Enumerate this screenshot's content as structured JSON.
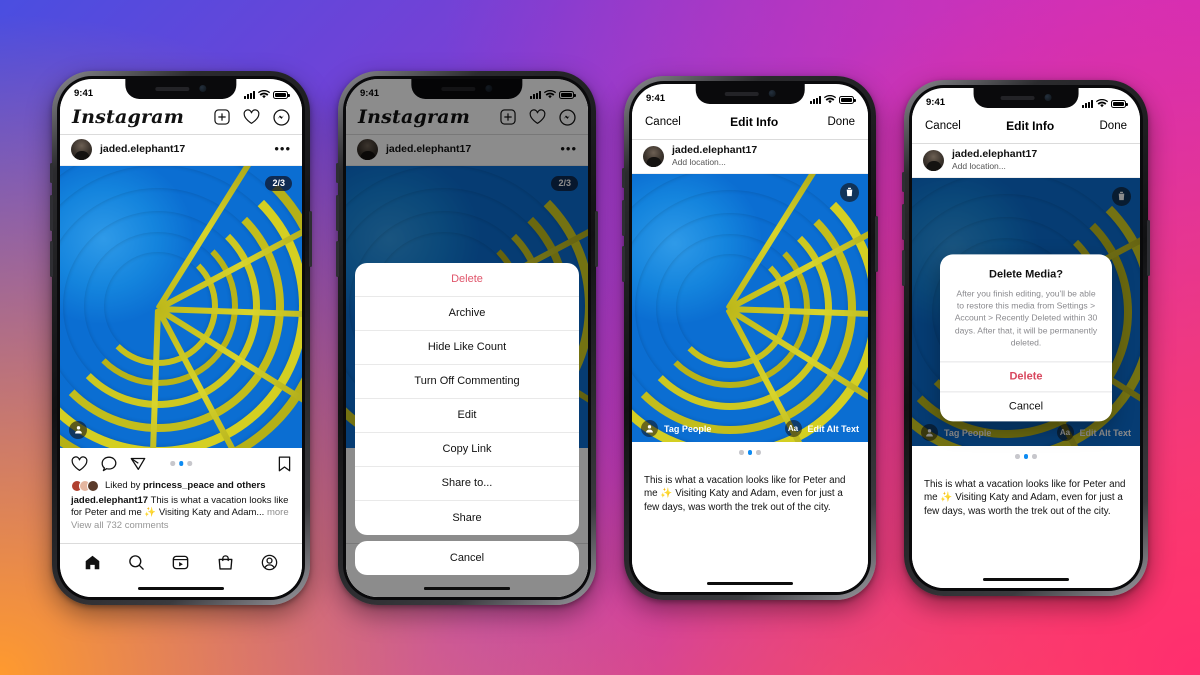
{
  "background": {
    "gradient_colors": [
      "#4a4ee0",
      "#7b3fd4",
      "#d62eb5",
      "#ff2d6f",
      "#ff9a2e"
    ]
  },
  "status_bar": {
    "time": "9:41",
    "signal_icon": "cellular-bars-icon",
    "wifi_icon": "wifi-icon",
    "battery_icon": "battery-icon"
  },
  "common": {
    "brand": "Instagram",
    "username": "jaded.elephant17",
    "add_location": "Add location...",
    "more_icon": "ellipsis-icon",
    "carousel_counter": "2/3"
  },
  "accent": {
    "blue": "#0d8bf2",
    "danger_red": "#e0556b",
    "alert_red": "#d8485f",
    "gray": "#8e8e8e"
  },
  "screen1": {
    "name": "instagram-feed",
    "header_actions": [
      "new-post-icon",
      "heart-icon",
      "messenger-icon"
    ],
    "post_actions": [
      "heart-icon",
      "comment-icon",
      "share-icon",
      "bookmark-icon"
    ],
    "likes_prefix": "Liked by",
    "likes_user": "princess_peace",
    "likes_suffix": "and others",
    "caption_user": "jaded.elephant17",
    "caption_text": "This is what a vacation looks like for Peter and me ✨ Visiting Katy and Adam...",
    "caption_more": "more",
    "caption_faded": "View all 732 comments",
    "tabbar": [
      "home-icon",
      "search-icon",
      "reels-icon",
      "shop-icon",
      "profile-icon"
    ],
    "carousel_dots": 3,
    "carousel_active": 1
  },
  "screen2": {
    "name": "post-options-action-sheet",
    "items": [
      {
        "label": "Delete",
        "style": "danger"
      },
      {
        "label": "Archive",
        "style": "normal"
      },
      {
        "label": "Hide Like Count",
        "style": "normal"
      },
      {
        "label": "Turn Off Commenting",
        "style": "normal"
      },
      {
        "label": "Edit",
        "style": "normal"
      },
      {
        "label": "Copy Link",
        "style": "normal"
      },
      {
        "label": "Share to...",
        "style": "normal"
      },
      {
        "label": "Share",
        "style": "normal"
      }
    ],
    "cancel": "Cancel"
  },
  "screen3": {
    "name": "edit-info",
    "nav_left": "Cancel",
    "nav_title": "Edit Info",
    "nav_right": "Done",
    "trash_icon": "trash-icon",
    "tag_people": "Tag People",
    "alt_text_badge": "Aa",
    "alt_text": "Edit Alt Text",
    "caption_text": "This is what a vacation looks like for Peter and me ✨ Visiting Katy and Adam, even for just a few days, was worth the trek out of the city.",
    "carousel_dots": 3,
    "carousel_active": 1
  },
  "screen4": {
    "name": "delete-media-confirmation",
    "nav_left": "Cancel",
    "nav_title": "Edit Info",
    "nav_right": "Done",
    "tag_people": "Tag People",
    "alt_text_badge": "Aa",
    "alt_text": "Edit Alt Text",
    "alert": {
      "title": "Delete Media?",
      "message": "After you finish editing, you'll be able to restore this media from Settings > Account > Recently Deleted within 30 days. After that, it will be permanently deleted.",
      "confirm": "Delete",
      "cancel": "Cancel"
    },
    "caption_text": "This is what a vacation looks like for Peter and me ✨ Visiting Katy and Adam, even for just a few days, was worth the trek out of the city.",
    "carousel_dots": 3,
    "carousel_active": 1
  }
}
